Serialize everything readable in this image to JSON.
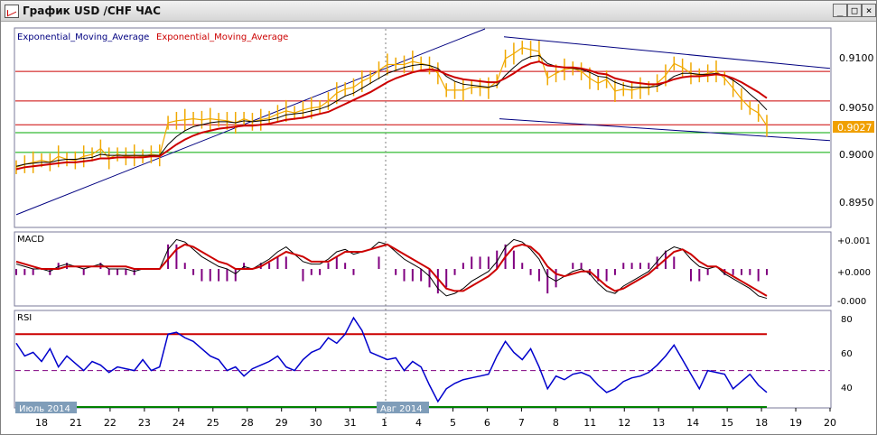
{
  "window": {
    "title": "График USD /CHF  ЧАС",
    "buttons": {
      "minimize": "_",
      "maximize": "□",
      "close": "×"
    }
  },
  "chart_data": [
    {
      "type": "line",
      "panel": "price",
      "legend": [
        "Exponential_Moving_Average",
        "Exponential_Moving_Average"
      ],
      "ylim": [
        0.8925,
        0.9125
      ],
      "y_ticks": [
        "0.9100",
        "0.9050",
        "0.9000",
        "0.8950"
      ],
      "current_value": "0.9027",
      "x_label_color": "#f0a000",
      "horizontal_lines": [
        {
          "y": 0.9082,
          "color": "#cc0000"
        },
        {
          "y": 0.9052,
          "color": "#cc0000"
        },
        {
          "y": 0.9028,
          "color": "#cc0000"
        },
        {
          "y": 0.902,
          "color": "#00aa00"
        },
        {
          "y": 0.9,
          "color": "#00aa00"
        }
      ],
      "close": [
        0.8985,
        0.8988,
        0.899,
        0.8992,
        0.899,
        0.8996,
        0.8993,
        0.8992,
        0.8996,
        0.8998,
        0.9004,
        0.8994,
        0.8998,
        0.8996,
        0.8997,
        0.8996,
        0.8998,
        0.8997,
        0.903,
        0.9032,
        0.9033,
        0.9034,
        0.9033,
        0.9034,
        0.9033,
        0.9032,
        0.903,
        0.9034,
        0.9031,
        0.9033,
        0.9035,
        0.9039,
        0.9042,
        0.904,
        0.9043,
        0.9045,
        0.9046,
        0.9052,
        0.906,
        0.9064,
        0.9066,
        0.9072,
        0.9076,
        0.9083,
        0.9089,
        0.9089,
        0.9089,
        0.9092,
        0.909,
        0.9088,
        0.908,
        0.9063,
        0.9063,
        0.9063,
        0.9066,
        0.9066,
        0.9065,
        0.9072,
        0.9095,
        0.91,
        0.9106,
        0.9104,
        0.9102,
        0.9075,
        0.908,
        0.9084,
        0.9085,
        0.9082,
        0.9075,
        0.907,
        0.9074,
        0.9062,
        0.9064,
        0.9063,
        0.9065,
        0.9065,
        0.907,
        0.9078,
        0.909,
        0.9086,
        0.908,
        0.9078,
        0.908,
        0.9082,
        0.9075,
        0.9065,
        0.9054,
        0.9045,
        0.904,
        0.9027
      ],
      "ema_fast": [
        0.8986,
        0.8988,
        0.8989,
        0.899,
        0.899,
        0.8992,
        0.8993,
        0.8993,
        0.8994,
        0.8995,
        0.8998,
        0.8997,
        0.8997,
        0.8997,
        0.8997,
        0.8997,
        0.8997,
        0.8997,
        0.9008,
        0.9016,
        0.9022,
        0.9026,
        0.9028,
        0.903,
        0.9031,
        0.9031,
        0.903,
        0.9032,
        0.9031,
        0.9032,
        0.9033,
        0.9035,
        0.9038,
        0.9039,
        0.904,
        0.9042,
        0.9044,
        0.9047,
        0.9052,
        0.9057,
        0.906,
        0.9065,
        0.907,
        0.9075,
        0.908,
        0.9083,
        0.9086,
        0.9088,
        0.9089,
        0.9088,
        0.9085,
        0.9077,
        0.9072,
        0.9069,
        0.9068,
        0.9067,
        0.9066,
        0.9068,
        0.9078,
        0.9086,
        0.9093,
        0.9097,
        0.9098,
        0.909,
        0.9087,
        0.9086,
        0.9085,
        0.9084,
        0.9081,
        0.9077,
        0.9076,
        0.9071,
        0.9068,
        0.9066,
        0.9066,
        0.9066,
        0.9067,
        0.9071,
        0.9077,
        0.908,
        0.908,
        0.9079,
        0.9079,
        0.908,
        0.9078,
        0.9073,
        0.9067,
        0.9059,
        0.9052,
        0.9043
      ],
      "ema_slow": [
        0.8983,
        0.8985,
        0.8986,
        0.8987,
        0.8988,
        0.8989,
        0.899,
        0.899,
        0.8991,
        0.8992,
        0.8994,
        0.8994,
        0.8995,
        0.8995,
        0.8995,
        0.8995,
        0.8996,
        0.8996,
        0.9002,
        0.9008,
        0.9013,
        0.9017,
        0.902,
        0.9022,
        0.9024,
        0.9025,
        0.9026,
        0.9027,
        0.9027,
        0.9028,
        0.9029,
        0.9031,
        0.9033,
        0.9034,
        0.9035,
        0.9037,
        0.9039,
        0.9041,
        0.9045,
        0.9049,
        0.9053,
        0.9057,
        0.9061,
        0.9066,
        0.9071,
        0.9075,
        0.9078,
        0.9081,
        0.9083,
        0.9084,
        0.9083,
        0.9079,
        0.9076,
        0.9074,
        0.9073,
        0.9072,
        0.9071,
        0.9071,
        0.9075,
        0.908,
        0.9086,
        0.909,
        0.9092,
        0.9088,
        0.9087,
        0.9086,
        0.9086,
        0.9085,
        0.9083,
        0.908,
        0.9079,
        0.9075,
        0.9073,
        0.9071,
        0.907,
        0.9069,
        0.9069,
        0.9071,
        0.9074,
        0.9076,
        0.9077,
        0.9077,
        0.9078,
        0.9079,
        0.9078,
        0.9075,
        0.9071,
        0.9066,
        0.9061,
        0.9055
      ]
    },
    {
      "type": "line",
      "panel": "macd",
      "label": "MACD",
      "ylim": [
        -0.0014,
        0.0014
      ],
      "y_ticks": [
        "+0.001",
        "+0.000",
        "-0.000"
      ],
      "macd": [
        0.0002,
        0.0001,
        0.0,
        0.0,
        -0.0001,
        0.0001,
        0.0002,
        0.0001,
        0.0,
        0.0001,
        0.0002,
        0.0,
        0.0,
        0.0,
        -0.0001,
        0.0,
        0.0,
        0.0,
        0.0008,
        0.0012,
        0.0011,
        0.0008,
        0.0005,
        0.0003,
        0.0001,
        0.0,
        -0.0002,
        0.0001,
        0.0,
        0.0002,
        0.0004,
        0.0007,
        0.0009,
        0.0006,
        0.0003,
        0.0002,
        0.0002,
        0.0004,
        0.0007,
        0.0008,
        0.0006,
        0.0007,
        0.0008,
        0.0011,
        0.001,
        0.0007,
        0.0004,
        0.0002,
        0.0,
        -0.0003,
        -0.0008,
        -0.0011,
        -0.001,
        -0.0008,
        -0.0005,
        -0.0003,
        -0.0001,
        0.0003,
        0.0009,
        0.0012,
        0.0011,
        0.0008,
        0.0004,
        -0.0003,
        -0.0005,
        -0.0003,
        -0.0001,
        0.0,
        -0.0002,
        -0.0006,
        -0.0009,
        -0.001,
        -0.0007,
        -0.0005,
        -0.0003,
        -0.0001,
        0.0003,
        0.0007,
        0.0009,
        0.0008,
        0.0004,
        0.0001,
        0.0,
        0.0001,
        -0.0002,
        -0.0004,
        -0.0006,
        -0.0008,
        -0.0011,
        -0.0012
      ],
      "signal": [
        0.0003,
        0.0002,
        0.0001,
        0.0,
        0.0,
        0.0,
        0.0001,
        0.0001,
        0.0001,
        0.0001,
        0.0001,
        0.0001,
        0.0001,
        0.0001,
        0.0,
        0.0,
        0.0,
        0.0,
        0.0004,
        0.0008,
        0.001,
        0.0009,
        0.0007,
        0.0005,
        0.0003,
        0.0002,
        0.0,
        0.0,
        0.0,
        0.0001,
        0.0003,
        0.0005,
        0.0007,
        0.0006,
        0.0005,
        0.0003,
        0.0003,
        0.0003,
        0.0005,
        0.0007,
        0.0007,
        0.0007,
        0.0008,
        0.0009,
        0.001,
        0.0008,
        0.0006,
        0.0004,
        0.0002,
        0.0,
        -0.0004,
        -0.0008,
        -0.0009,
        -0.0009,
        -0.0007,
        -0.0005,
        -0.0003,
        0.0,
        0.0005,
        0.0009,
        0.001,
        0.0009,
        0.0006,
        0.0001,
        -0.0002,
        -0.0003,
        -0.0002,
        -0.0001,
        -0.0001,
        -0.0004,
        -0.0007,
        -0.0009,
        -0.0008,
        -0.0006,
        -0.0004,
        -0.0002,
        0.0001,
        0.0004,
        0.0007,
        0.0008,
        0.0006,
        0.0003,
        0.0001,
        0.0001,
        -0.0001,
        -0.0003,
        -0.0005,
        -0.0007,
        -0.0009,
        -0.0011
      ]
    },
    {
      "type": "line",
      "panel": "rsi",
      "label": "RSI",
      "ylim": [
        30,
        82
      ],
      "y_ticks": [
        "80",
        "60",
        "40"
      ],
      "levels": [
        70,
        50,
        30
      ],
      "values": [
        65,
        58,
        60,
        55,
        62,
        52,
        58,
        54,
        50,
        55,
        53,
        49,
        52,
        51,
        50,
        56,
        50,
        52,
        70,
        71,
        68,
        66,
        62,
        58,
        56,
        50,
        52,
        47,
        51,
        53,
        55,
        58,
        52,
        50,
        56,
        60,
        62,
        68,
        65,
        70,
        79,
        72,
        60,
        58,
        56,
        57,
        50,
        55,
        52,
        42,
        33,
        40,
        43,
        45,
        46,
        47,
        48,
        58,
        66,
        60,
        56,
        62,
        52,
        40,
        47,
        45,
        48,
        49,
        47,
        42,
        38,
        40,
        44,
        46,
        47,
        49,
        53,
        58,
        64,
        56,
        48,
        40,
        50,
        49,
        48,
        40,
        44,
        48,
        42,
        38
      ]
    }
  ],
  "x_axis": {
    "labels": [
      "18",
      "21",
      "22",
      "23",
      "24",
      "25",
      "28",
      "29",
      "30",
      "31",
      "1",
      "4",
      "5",
      "6",
      "7",
      "8",
      "11",
      "12",
      "13",
      "14",
      "15",
      "18",
      "19",
      "20"
    ],
    "month_tags": [
      "Июль 2014",
      "Авг 2014"
    ]
  }
}
